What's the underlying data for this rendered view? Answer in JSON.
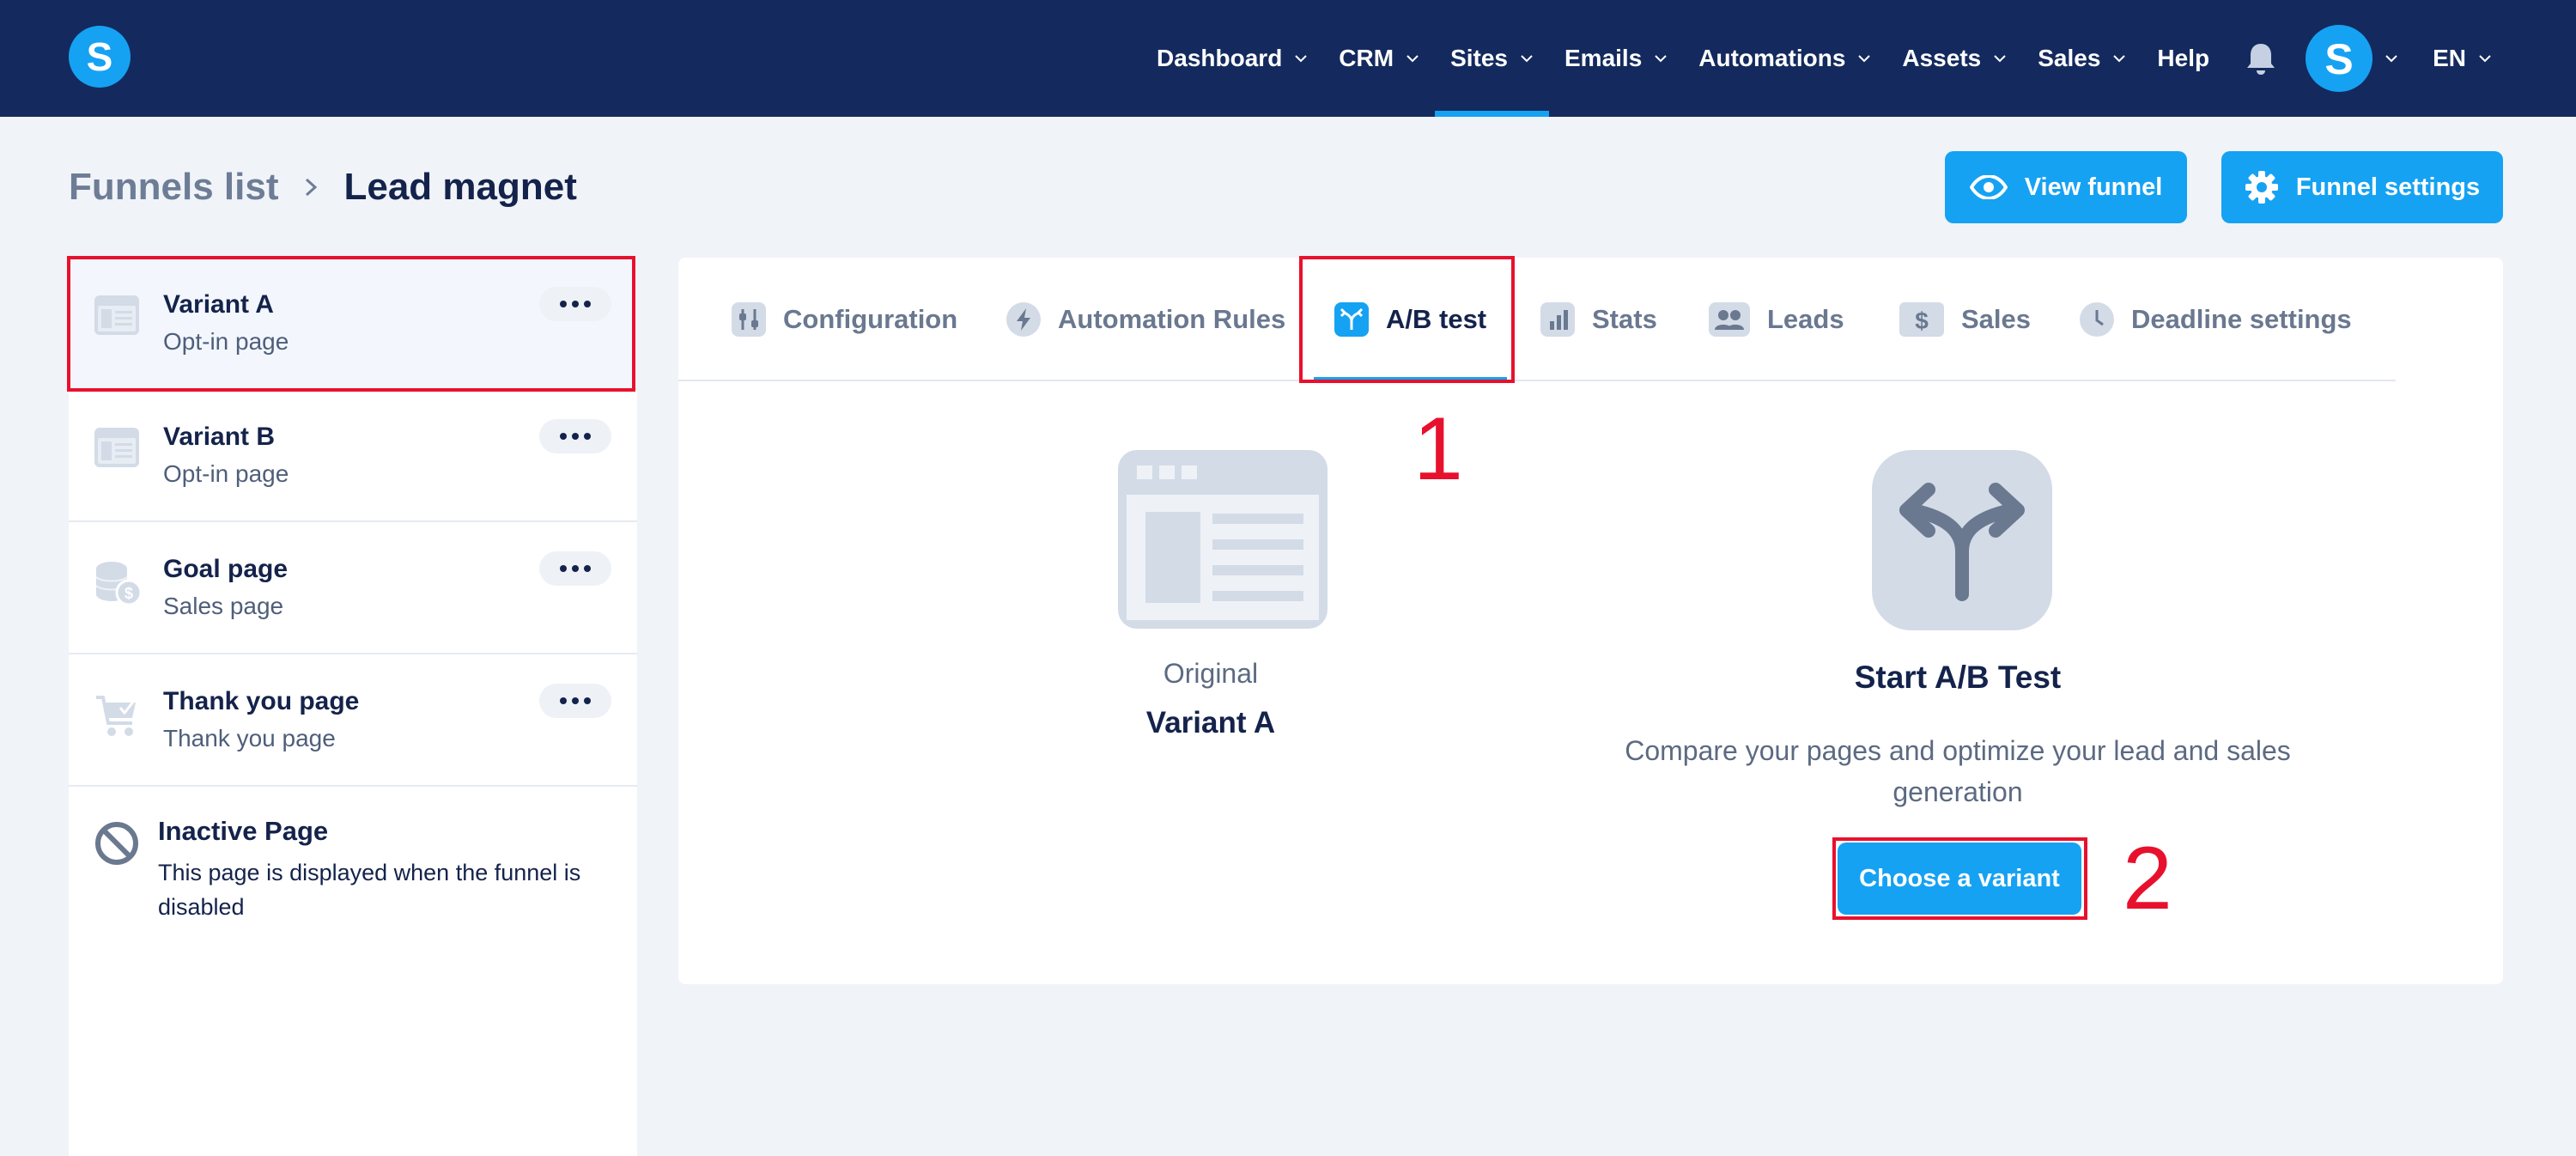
{
  "topnav": {
    "logo_letter": "S",
    "items": [
      {
        "label": "Dashboard",
        "has_dropdown": true
      },
      {
        "label": "CRM",
        "has_dropdown": true
      },
      {
        "label": "Sites",
        "has_dropdown": true,
        "active": true
      },
      {
        "label": "Emails",
        "has_dropdown": true
      },
      {
        "label": "Automations",
        "has_dropdown": true
      },
      {
        "label": "Assets",
        "has_dropdown": true
      },
      {
        "label": "Sales",
        "has_dropdown": true
      },
      {
        "label": "Help",
        "has_dropdown": false
      }
    ],
    "notifications_icon": "bell-icon",
    "avatar_letter": "S",
    "language": "EN"
  },
  "breadcrumb": {
    "parent": "Funnels list",
    "current": "Lead magnet"
  },
  "header_actions": {
    "view_funnel": "View funnel",
    "funnel_settings": "Funnel settings"
  },
  "pages": [
    {
      "title": "Variant A",
      "subtitle": "Opt-in page",
      "icon": "page-layout-icon",
      "selected": true
    },
    {
      "title": "Variant B",
      "subtitle": "Opt-in page",
      "icon": "page-layout-icon"
    },
    {
      "title": "Goal page",
      "subtitle": "Sales page",
      "icon": "coins-icon"
    },
    {
      "title": "Thank you page",
      "subtitle": "Thank you page",
      "icon": "cart-check-icon"
    }
  ],
  "inactive_page": {
    "title": "Inactive Page",
    "description": "This page is displayed when the funnel is disabled",
    "icon": "ban-icon"
  },
  "tabs": [
    {
      "label": "Configuration",
      "icon": "sliders-icon"
    },
    {
      "label": "Automation Rules",
      "icon": "bolt-icon"
    },
    {
      "label": "A/B test",
      "icon": "split-icon",
      "active": true
    },
    {
      "label": "Stats",
      "icon": "bar-chart-icon"
    },
    {
      "label": "Leads",
      "icon": "users-icon"
    },
    {
      "label": "Sales",
      "icon": "dollar-icon"
    },
    {
      "label": "Deadline settings",
      "icon": "clock-icon"
    }
  ],
  "ab_test": {
    "original_label": "Original",
    "original_variant": "Variant A",
    "start_title": "Start A/B Test",
    "start_description": "Compare your pages and optimize your lead and sales generation",
    "choose_button": "Choose a variant"
  },
  "annotations": {
    "step1": "1",
    "step2": "2"
  },
  "colors": {
    "navbar": "#142a5e",
    "accent": "#16a2f2",
    "annotation": "#e8112d",
    "background": "#f0f3f8"
  }
}
